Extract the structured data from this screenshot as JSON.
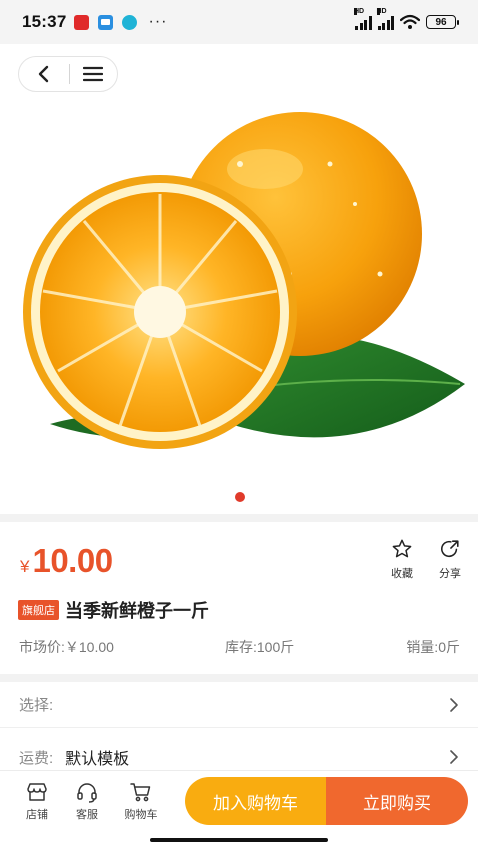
{
  "status_bar": {
    "time": "15:37",
    "dots": "···",
    "signal_badge_1": "HD",
    "signal_badge_2": "HD",
    "battery": "96"
  },
  "nav": {
    "back_icon": "chevron-left-icon",
    "menu_icon": "hamburger-menu-icon"
  },
  "gallery": {
    "image": "orange-fruit-with-leaf",
    "slide_count": 1,
    "active_slide": 1,
    "indicator_color": "#e03a2a"
  },
  "product": {
    "currency_symbol": "¥",
    "price": "10.00",
    "badge": "旗舰店",
    "title": "当季新鲜橙子一斤",
    "market_price": "市场价:￥10.00",
    "stock": "库存:100斤",
    "sales": "销量:0斤",
    "accent_color": "#e8532a"
  },
  "actions": {
    "favorite_label": "收藏",
    "share_label": "分享"
  },
  "options": {
    "select_label": "选择:",
    "shipping_label": "运费:",
    "shipping_value": "默认模板"
  },
  "bottom_bar": {
    "store_label": "店铺",
    "service_label": "客服",
    "cart_label": "购物车",
    "add_to_cart": "加入购物车",
    "buy_now": "立即购买",
    "add_to_cart_color": "#f9ac10",
    "buy_now_color": "#f0682e"
  }
}
